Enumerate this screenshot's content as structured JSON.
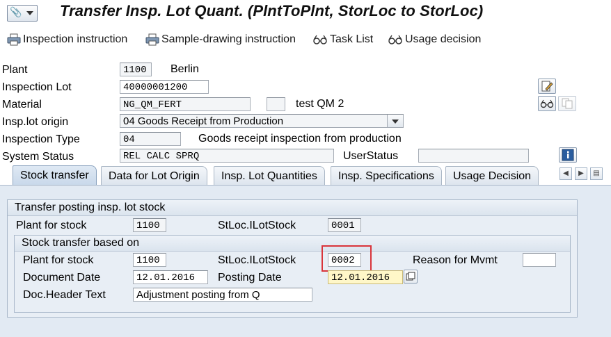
{
  "title": "Transfer Insp. Lot Quant. (PlntToPlnt, StorLoc to StorLoc)",
  "toolbar": {
    "inspection_instruction": "Inspection instruction",
    "sample_drawing_instruction": "Sample-drawing instruction",
    "task_list": "Task List",
    "usage_decision": "Usage decision"
  },
  "header": {
    "plant_label": "Plant",
    "plant_value": "1100",
    "plant_name": "Berlin",
    "inspection_lot_label": "Inspection Lot",
    "inspection_lot_value": "40000001200",
    "material_label": "Material",
    "material_value": "NG_QM_FERT",
    "material_desc": "test QM 2",
    "lot_origin_label": "Insp.lot origin",
    "lot_origin_value": "04 Goods Receipt from Production",
    "insp_type_label": "Inspection Type",
    "insp_type_value": "04",
    "insp_type_desc": "Goods receipt inspection from production",
    "system_status_label": "System Status",
    "system_status_value": "REL  CALC SPRQ",
    "user_status_label": "UserStatus",
    "user_status_value": ""
  },
  "tabs": [
    {
      "label": "Stock transfer",
      "active": true
    },
    {
      "label": "Data for Lot Origin",
      "active": false
    },
    {
      "label": "Insp. Lot Quantities",
      "active": false
    },
    {
      "label": "Insp. Specifications",
      "active": false
    },
    {
      "label": "Usage Decision",
      "active": false
    }
  ],
  "transfer_group": {
    "title": "Transfer posting insp. lot stock",
    "plant_label": "Plant for stock",
    "plant_value": "1100",
    "stloc_label": "StLoc.ILotStock",
    "stloc_value": "0001"
  },
  "stock_transfer_group": {
    "title": "Stock transfer based on",
    "plant_label": "Plant for stock",
    "plant_value": "1100",
    "stloc_label": "StLoc.ILotStock",
    "stloc_value": "0002",
    "reason_label": "Reason for Mvmt",
    "reason_value": "",
    "doc_date_label": "Document Date",
    "doc_date_value": "12.01.2016",
    "posting_date_label": "Posting Date",
    "posting_date_value": "12.01.2016",
    "doc_header_label": "Doc.Header Text",
    "doc_header_value": "Adjustment posting from Q"
  },
  "colors": {
    "accent_highlight": "#d9343a",
    "tab_background": "#e2eaf3",
    "required_field": "#fff7c8"
  }
}
